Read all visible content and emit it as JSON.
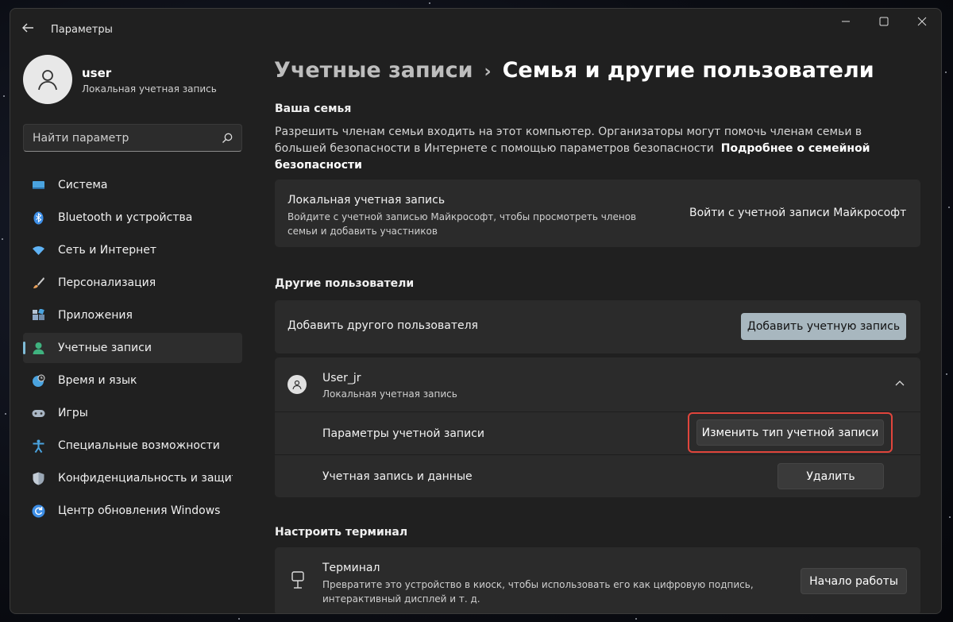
{
  "window": {
    "title": "Параметры",
    "controls": {
      "minimize": "—",
      "maximize": "☐",
      "close": "✕"
    }
  },
  "profile": {
    "name": "user",
    "type": "Локальная учетная запись"
  },
  "search": {
    "placeholder": "Найти параметр"
  },
  "nav": {
    "items": [
      {
        "label": "Система",
        "icon": "system-icon",
        "color": "#4aa3df"
      },
      {
        "label": "Bluetooth и устройства",
        "icon": "bluetooth-icon",
        "color": "#3d8ee6"
      },
      {
        "label": "Сеть и Интернет",
        "icon": "wifi-icon",
        "color": "#5fb3f5"
      },
      {
        "label": "Персонализация",
        "icon": "brush-icon",
        "color": "#e8a05c"
      },
      {
        "label": "Приложения",
        "icon": "apps-icon",
        "color": "#8fa9c7"
      },
      {
        "label": "Учетные записи",
        "icon": "accounts-icon",
        "color": "#3fb27f",
        "active": true
      },
      {
        "label": "Время и язык",
        "icon": "globe-clock-icon",
        "color": "#4aa3df"
      },
      {
        "label": "Игры",
        "icon": "gamepad-icon",
        "color": "#a9b6c4"
      },
      {
        "label": "Специальные возможности",
        "icon": "accessibility-icon",
        "color": "#4aa3df"
      },
      {
        "label": "Конфиденциальность и защита",
        "icon": "shield-icon",
        "color": "#9aa7b5"
      },
      {
        "label": "Центр обновления Windows",
        "icon": "update-icon",
        "color": "#3d8ee6"
      }
    ]
  },
  "breadcrumb": {
    "parent": "Учетные записи",
    "separator": "›",
    "current": "Семья и другие пользователи"
  },
  "family": {
    "title": "Ваша семья",
    "description": "Разрешить членам семьи входить на этот компьютер. Организаторы могут помочь членам семьи в большей безопасности в Интернете с помощью параметров безопасности",
    "link": "Подробнее о семейной безопасности",
    "card": {
      "title": "Локальная учетная запись",
      "subtitle": "Войдите с учетной записью Майкрософт, чтобы просмотреть членов семьи и добавить участников",
      "action": "Войти с учетной записи Майкрософт"
    }
  },
  "others": {
    "title": "Другие пользователи",
    "add_label": "Добавить другого пользователя",
    "add_button": "Добавить учетную запись",
    "user": {
      "name": "User_jr",
      "type": "Локальная учетная запись",
      "options_label": "Параметры учетной записи",
      "change_button": "Изменить тип учетной записи",
      "data_label": "Учетная запись и данные",
      "delete_button": "Удалить"
    }
  },
  "kiosk": {
    "title": "Настроить терминал",
    "card_title": "Терминал",
    "card_subtitle": "Превратите это устройство в киоск, чтобы использовать его как цифровую подпись, интерактивный дисплей и т. д.",
    "button": "Начало работы"
  },
  "colors": {
    "accent": "#a8b7bf",
    "highlight": "#e0453c",
    "window_bg": "#202020",
    "card_bg": "#2b2b2b"
  }
}
